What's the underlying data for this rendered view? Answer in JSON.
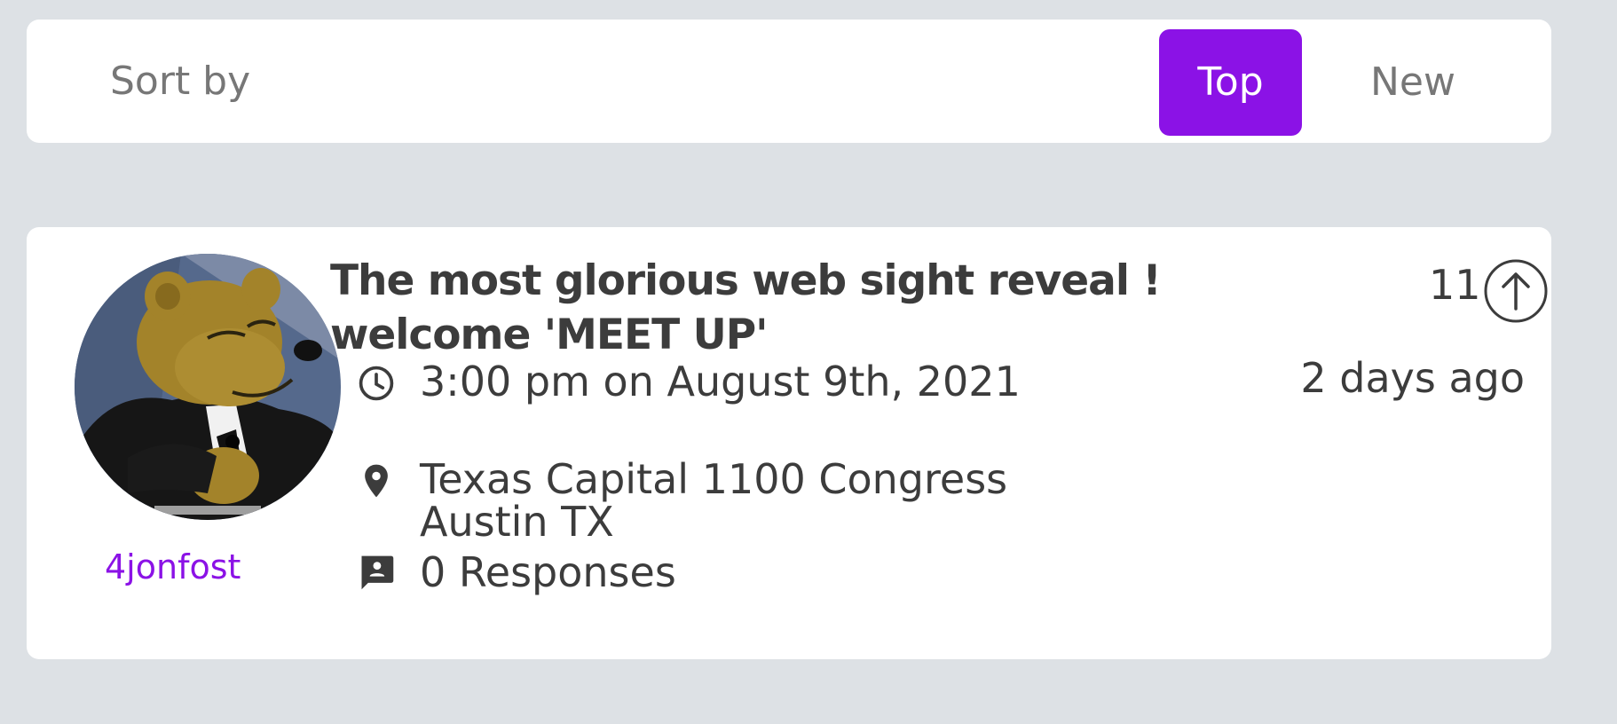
{
  "colors": {
    "accent": "#8b12e6",
    "page_background": "#dde1e5",
    "card_background": "#ffffff",
    "text": "#3c3c3c",
    "muted_text": "#777777"
  },
  "sort": {
    "label": "Sort by",
    "tabs": [
      {
        "label": "Top",
        "selected": true
      },
      {
        "label": "New",
        "selected": false
      }
    ]
  },
  "post": {
    "avatar_icon": "bear-in-tuxedo-avatar",
    "author": "4jonfost",
    "title": "The most glorious web sight reveal ! welcome 'MEET UP'",
    "time_icon": "clock-icon",
    "time": "3:00 pm on August 9th, 2021",
    "location_icon": "map-pin-icon",
    "location_line1": "Texas Capital 1100 Congress",
    "location_line2": "Austin TX",
    "responses_icon": "comment-icon",
    "responses": "0 Responses",
    "score": "11",
    "upvote_icon": "arrow-up-circle-icon",
    "age": "2 days ago"
  }
}
